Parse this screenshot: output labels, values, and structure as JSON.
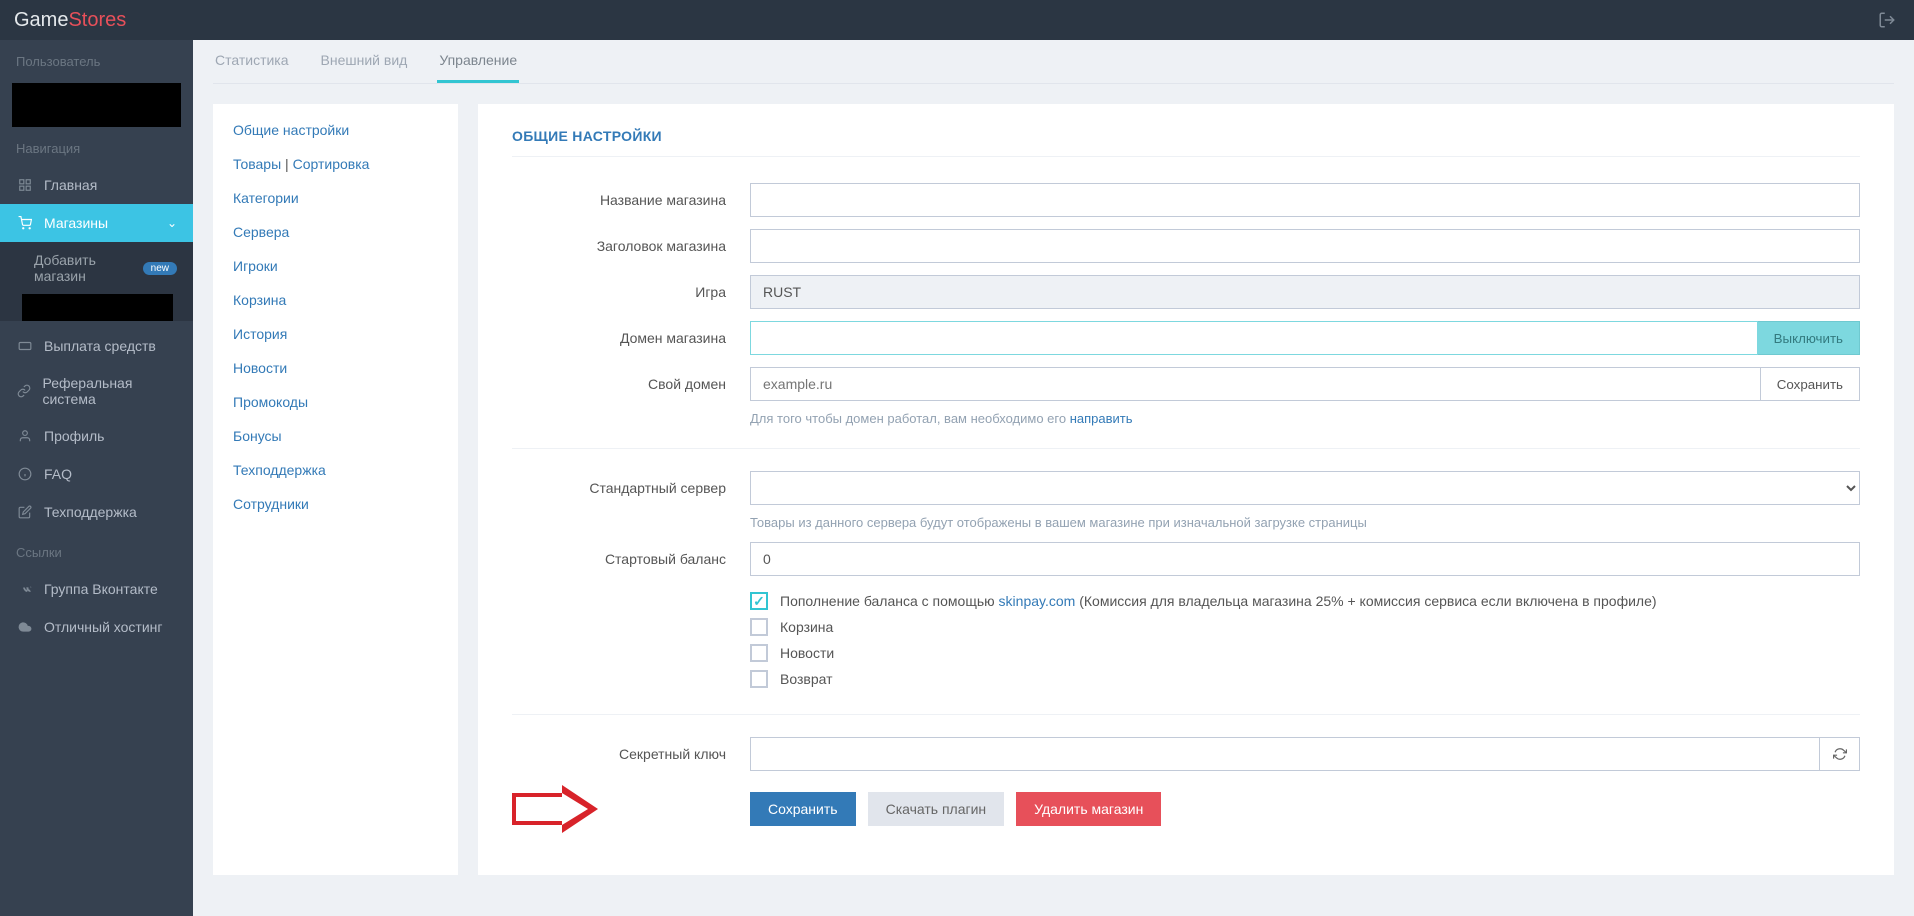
{
  "header": {
    "logo1": "Game",
    "logo2": "Stores"
  },
  "sidebar": {
    "sect_user": "Пользователь",
    "sect_nav": "Навигация",
    "items": {
      "home": "Главная",
      "shops": "Магазины",
      "add_shop": "Добавить магазин",
      "add_shop_badge": "new",
      "payout": "Выплата средств",
      "referral": "Реферальная система",
      "profile": "Профиль",
      "faq": "FAQ",
      "support": "Техподдержка"
    },
    "sect_links": "Ссылки",
    "links": {
      "vk": "Группа Вконтакте",
      "hosting": "Отличный хостинг"
    }
  },
  "tabs": {
    "stats": "Статистика",
    "appearance": "Внешний вид",
    "manage": "Управление"
  },
  "submenu": {
    "general": "Общие настройки",
    "goods": "Товары",
    "sep": " | ",
    "sorting": "Сортировка",
    "categories": "Категории",
    "servers": "Сервера",
    "players": "Игроки",
    "cart": "Корзина",
    "history": "История",
    "news": "Новости",
    "promo": "Промокоды",
    "bonuses": "Бонусы",
    "support": "Техподдержка",
    "staff": "Сотрудники"
  },
  "form": {
    "title": "ОБЩИЕ НАСТРОЙКИ",
    "labels": {
      "shop_name": "Название магазина",
      "shop_title": "Заголовок магазина",
      "game": "Игра",
      "shop_domain": "Домен магазина",
      "own_domain": "Свой домен",
      "default_server": "Стандартный сервер",
      "start_balance": "Стартовый баланс",
      "secret_key": "Секретный ключ"
    },
    "values": {
      "shop_name": "",
      "shop_title": "",
      "game": "RUST",
      "shop_domain": "",
      "own_domain_placeholder": "example.ru",
      "start_balance": "0"
    },
    "buttons": {
      "disable": "Выключить",
      "save_domain": "Сохранить",
      "save": "Сохранить",
      "download_plugin": "Скачать плагин",
      "delete_shop": "Удалить магазин"
    },
    "help": {
      "domain_pre": "Для того чтобы домен работал, вам необходимо его ",
      "domain_link": "направить",
      "server": "Товары из данного сервера будут отображены в вашем магазине при изначальной загрузке страницы"
    },
    "checks": {
      "skinpay_pre": "Пополнение баланса с помощью ",
      "skinpay_link": "skinpay.com",
      "skinpay_post": " (Комиссия для владельца магазина 25% + комиссия сервиса если включена в профиле)",
      "cart": "Корзина",
      "news": "Новости",
      "refund": "Возврат"
    }
  }
}
